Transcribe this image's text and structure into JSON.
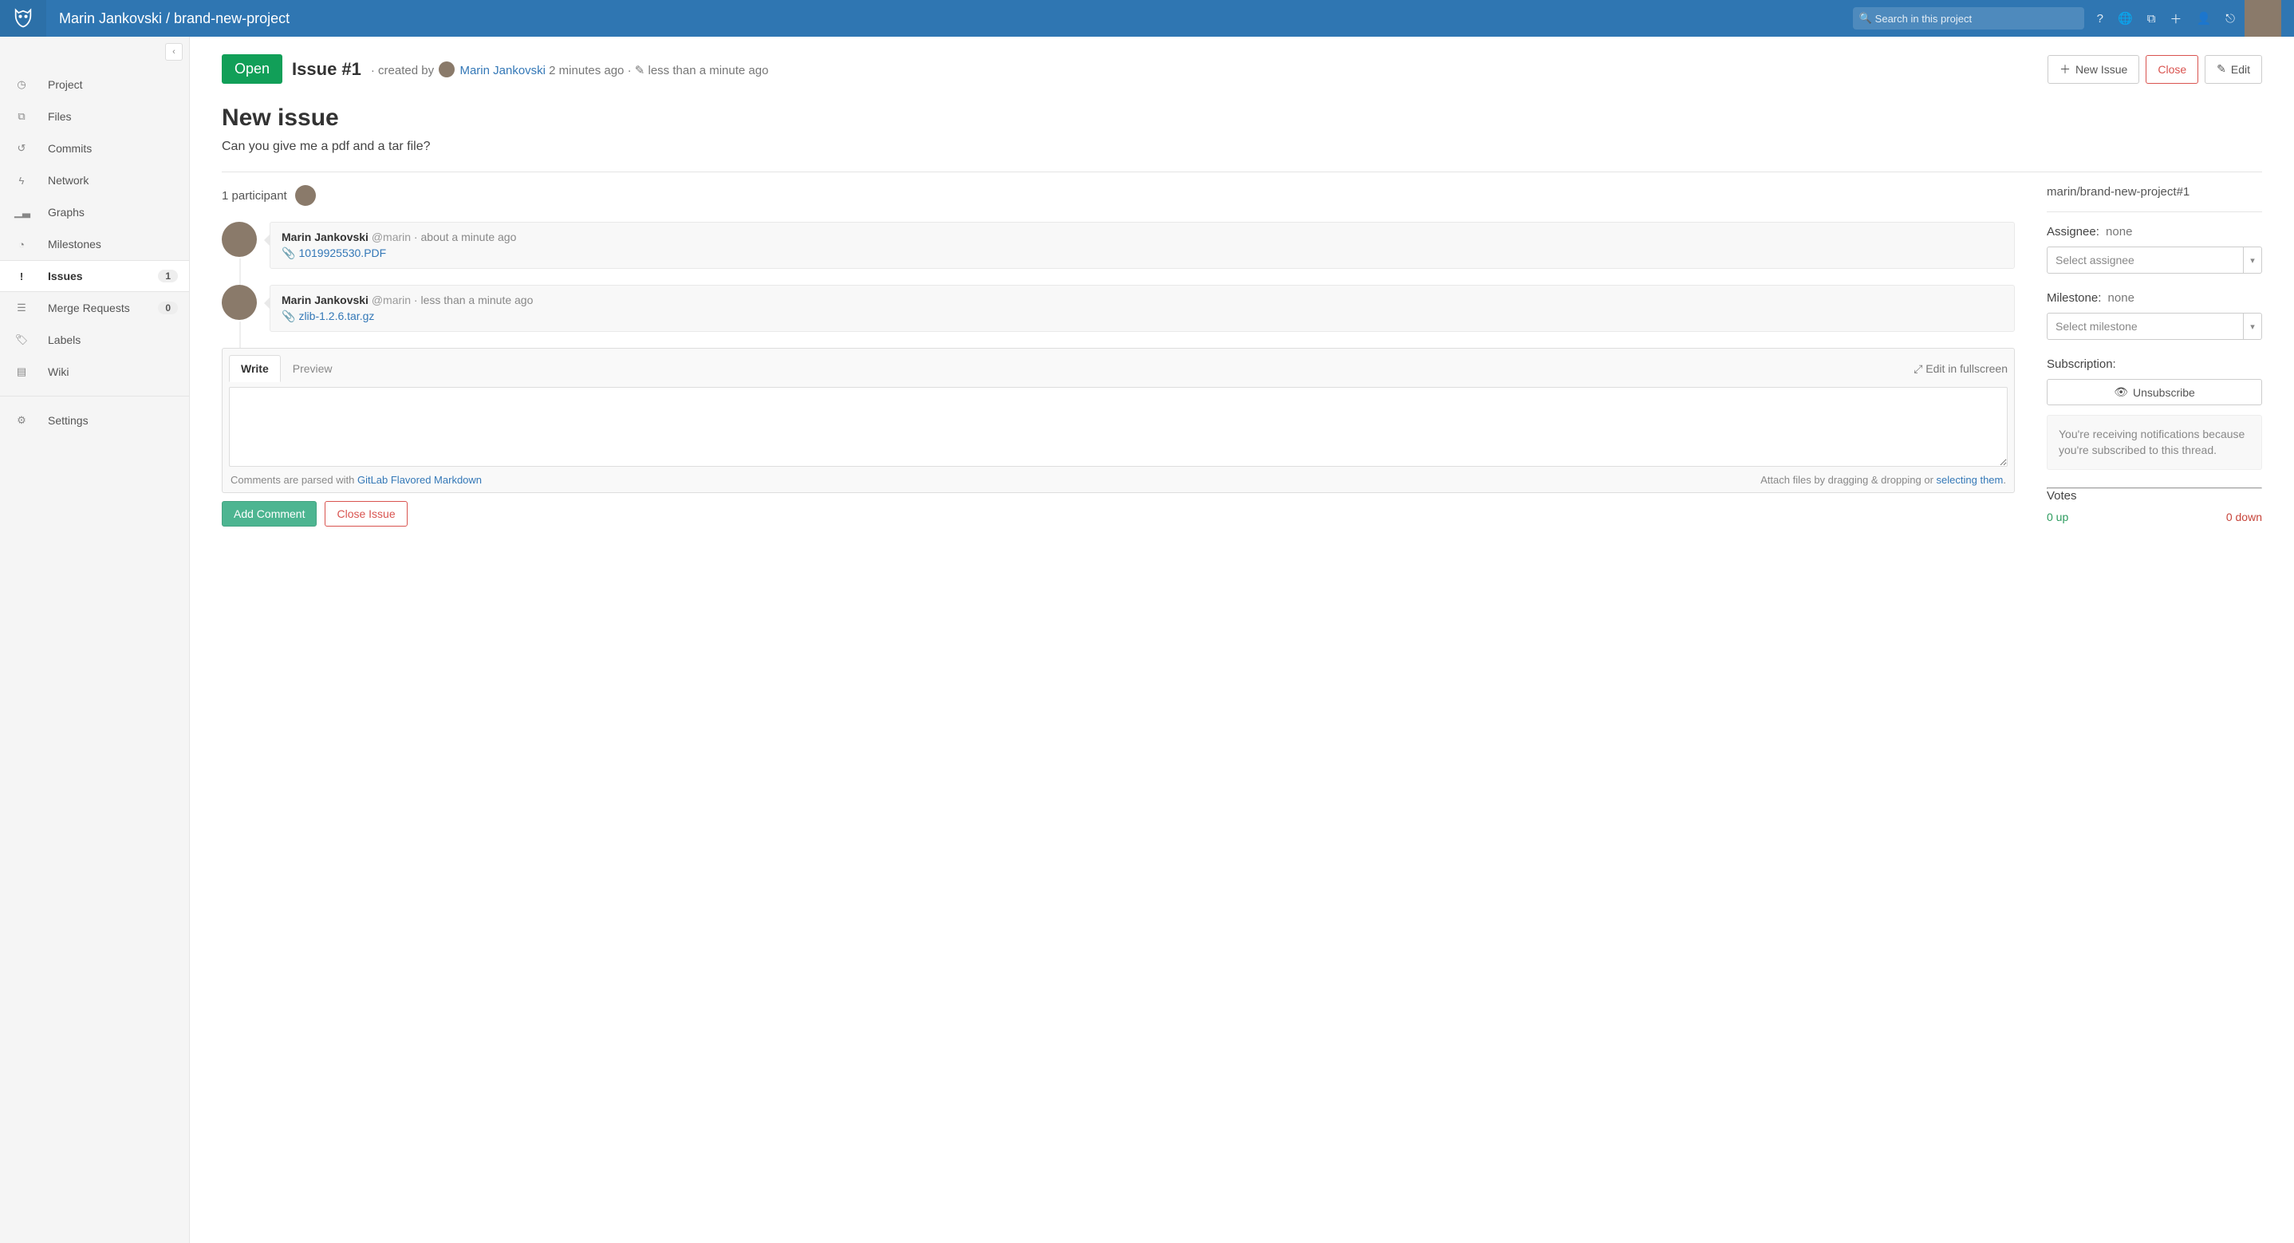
{
  "header": {
    "breadcrumb": "Marin Jankovski / brand-new-project",
    "search_placeholder": "Search in this project"
  },
  "sidebar": {
    "items": [
      {
        "label": "Project",
        "icon": "dashboard-icon"
      },
      {
        "label": "Files",
        "icon": "files-icon"
      },
      {
        "label": "Commits",
        "icon": "history-icon"
      },
      {
        "label": "Network",
        "icon": "fork-icon"
      },
      {
        "label": "Graphs",
        "icon": "chart-icon"
      },
      {
        "label": "Milestones",
        "icon": "clock-icon"
      },
      {
        "label": "Issues",
        "icon": "exclaim-icon",
        "badge": "1",
        "active": true
      },
      {
        "label": "Merge Requests",
        "icon": "tasks-icon",
        "badge": "0"
      },
      {
        "label": "Labels",
        "icon": "tags-icon"
      },
      {
        "label": "Wiki",
        "icon": "book-icon"
      }
    ],
    "settings_label": "Settings"
  },
  "issue": {
    "status": "Open",
    "id": "Issue #1",
    "created_by_prefix": "· created by",
    "author": "Marin Jankovski",
    "created_ago": "2 minutes ago",
    "updated_sep": "·",
    "updated_ago": "less than a minute ago",
    "title": "New issue",
    "description": "Can you give me a pdf and a tar file?",
    "participant_text": "1 participant"
  },
  "actions": {
    "new_issue": "New Issue",
    "close": "Close",
    "edit": "Edit",
    "add_comment": "Add Comment",
    "close_issue": "Close Issue"
  },
  "comments": [
    {
      "author": "Marin Jankovski",
      "handle": "@marin",
      "time": "about a minute ago",
      "attachment": "1019925530.PDF"
    },
    {
      "author": "Marin Jankovski",
      "handle": "@marin",
      "time": "less than a minute ago",
      "attachment": "zlib-1.2.6.tar.gz"
    }
  ],
  "editor": {
    "write_tab": "Write",
    "preview_tab": "Preview",
    "fullscreen": "Edit in fullscreen",
    "hint_prefix": "Comments are parsed with ",
    "hint_link": "GitLab Flavored Markdown",
    "attach_prefix": "Attach files by dragging & dropping or ",
    "attach_link": "selecting them",
    "attach_suffix": "."
  },
  "sidepanel": {
    "reference": "marin/brand-new-project#1",
    "assignee_label": "Assignee:",
    "assignee_value": "none",
    "assignee_placeholder": "Select assignee",
    "milestone_label": "Milestone:",
    "milestone_value": "none",
    "milestone_placeholder": "Select milestone",
    "subscription_label": "Subscription:",
    "unsubscribe": "Unsubscribe",
    "notify_text": "You're receiving notifications because you're subscribed to this thread.",
    "votes_label": "Votes",
    "votes_up": "0 up",
    "votes_down": "0 down"
  }
}
